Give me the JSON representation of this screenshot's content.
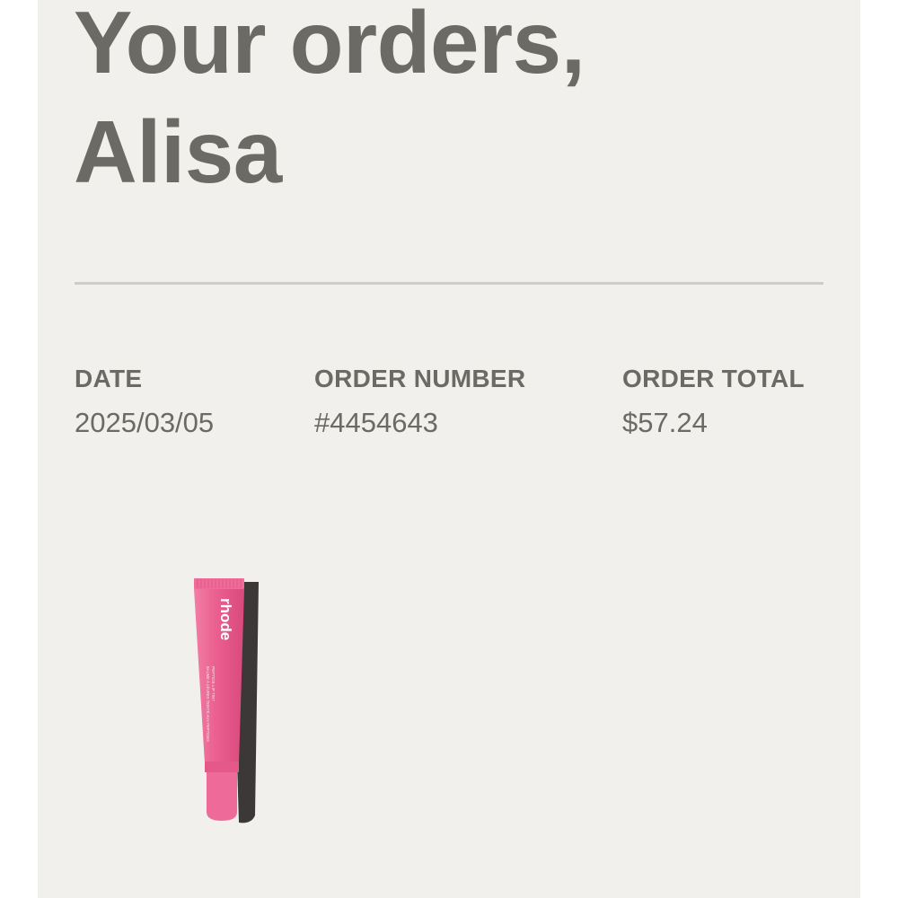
{
  "heading": {
    "line1": "Your orders,",
    "line2": "Alisa"
  },
  "order": {
    "date_label": "DATE",
    "date_value": "2025/03/05",
    "number_label": "ORDER NUMBER",
    "number_value": "#4454643",
    "total_label": "ORDER TOTAL",
    "total_value": "$57.24"
  },
  "product": {
    "brand": "rhode",
    "line_text_1": "PEPTIDE LIP TINT",
    "line_text_2": "BAUME À LÈVRES TEINTÉ AUX PEPTIDES",
    "tube_color": "#ea5f8f"
  },
  "colors": {
    "background": "#f1f0ed",
    "text": "#6b6a64",
    "divider": "#cfcdca"
  }
}
